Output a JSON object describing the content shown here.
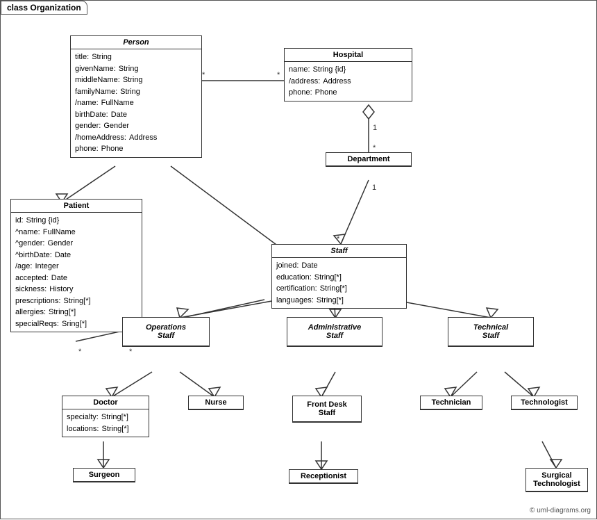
{
  "diagram": {
    "title": "class Organization",
    "copyright": "© uml-diagrams.org",
    "classes": {
      "person": {
        "name": "Person",
        "italic": true,
        "attrs": [
          {
            "name": "title:",
            "type": "String"
          },
          {
            "name": "givenName:",
            "type": "String"
          },
          {
            "name": "middleName:",
            "type": "String"
          },
          {
            "name": "familyName:",
            "type": "String"
          },
          {
            "name": "/name:",
            "type": "FullName"
          },
          {
            "name": "birthDate:",
            "type": "Date"
          },
          {
            "name": "gender:",
            "type": "Gender"
          },
          {
            "name": "/homeAddress:",
            "type": "Address"
          },
          {
            "name": "phone:",
            "type": "Phone"
          }
        ]
      },
      "hospital": {
        "name": "Hospital",
        "italic": false,
        "attrs": [
          {
            "name": "name:",
            "type": "String {id}"
          },
          {
            "name": "/address:",
            "type": "Address"
          },
          {
            "name": "phone:",
            "type": "Phone"
          }
        ]
      },
      "department": {
        "name": "Department",
        "italic": false,
        "attrs": []
      },
      "staff": {
        "name": "Staff",
        "italic": true,
        "attrs": [
          {
            "name": "joined:",
            "type": "Date"
          },
          {
            "name": "education:",
            "type": "String[*]"
          },
          {
            "name": "certification:",
            "type": "String[*]"
          },
          {
            "name": "languages:",
            "type": "String[*]"
          }
        ]
      },
      "patient": {
        "name": "Patient",
        "italic": false,
        "attrs": [
          {
            "name": "id:",
            "type": "String {id}"
          },
          {
            "name": "^name:",
            "type": "FullName"
          },
          {
            "name": "^gender:",
            "type": "Gender"
          },
          {
            "name": "^birthDate:",
            "type": "Date"
          },
          {
            "name": "/age:",
            "type": "Integer"
          },
          {
            "name": "accepted:",
            "type": "Date"
          },
          {
            "name": "sickness:",
            "type": "History"
          },
          {
            "name": "prescriptions:",
            "type": "String[*]"
          },
          {
            "name": "allergies:",
            "type": "String[*]"
          },
          {
            "name": "specialReqs:",
            "type": "Sring[*]"
          }
        ]
      },
      "operations_staff": {
        "name": "Operations Staff",
        "italic": true
      },
      "administrative_staff": {
        "name": "Administrative Staff",
        "italic": true
      },
      "technical_staff": {
        "name": "Technical Staff",
        "italic": true
      },
      "doctor": {
        "name": "Doctor",
        "italic": false,
        "attrs": [
          {
            "name": "specialty:",
            "type": "String[*]"
          },
          {
            "name": "locations:",
            "type": "String[*]"
          }
        ]
      },
      "nurse": {
        "name": "Nurse",
        "italic": false,
        "attrs": []
      },
      "front_desk_staff": {
        "name": "Front Desk Staff",
        "italic": false,
        "attrs": []
      },
      "technician": {
        "name": "Technician",
        "italic": false,
        "attrs": []
      },
      "technologist": {
        "name": "Technologist",
        "italic": false,
        "attrs": []
      },
      "surgeon": {
        "name": "Surgeon",
        "italic": false,
        "attrs": []
      },
      "receptionist": {
        "name": "Receptionist",
        "italic": false,
        "attrs": []
      },
      "surgical_technologist": {
        "name": "Surgical Technologist",
        "italic": false,
        "attrs": []
      }
    }
  }
}
